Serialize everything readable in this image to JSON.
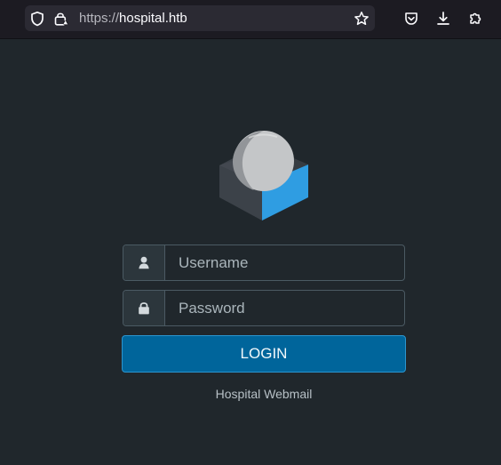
{
  "browser": {
    "url_scheme": "https://",
    "url_host": "hospital.htb",
    "icons": {
      "shield": "shield-icon",
      "lock": "lock-icon",
      "bookmark": "star-icon",
      "pocket": "pocket-icon",
      "downloads": "download-icon",
      "extensions": "extensions-icon"
    }
  },
  "login": {
    "username_placeholder": "Username",
    "password_placeholder": "Password",
    "login_label": "LOGIN",
    "app_name": "Hospital Webmail"
  },
  "theme": {
    "background": "#20272c",
    "input_border": "#4b5a63",
    "button": "#00659b",
    "button_border": "#2b95cf",
    "logo_blue": "#2f9de2",
    "logo_dark": "#3c4249",
    "logo_gray": "#c4c6c8"
  }
}
